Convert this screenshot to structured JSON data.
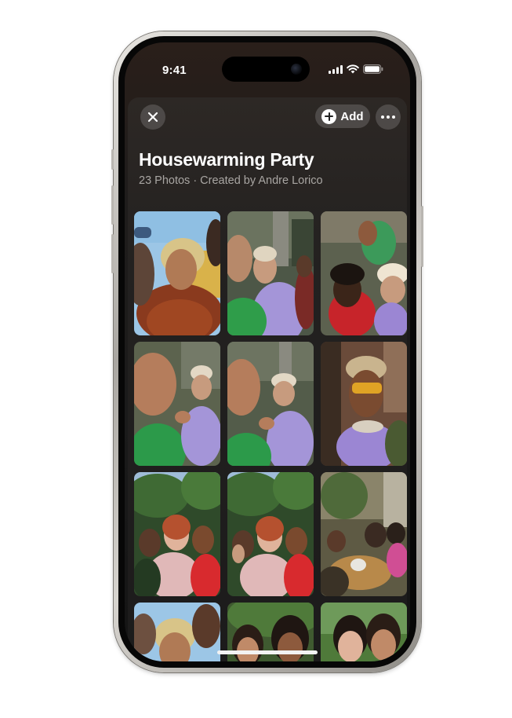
{
  "status_bar": {
    "time": "9:41",
    "icons": [
      "signal-icon",
      "wifi-icon",
      "battery-icon"
    ]
  },
  "header": {
    "close_icon": "close-icon",
    "add_label": "Add",
    "add_icon": "plus-circle-icon",
    "more_icon": "more-icon"
  },
  "album": {
    "title": "Housewarming Party",
    "subtitle": "23 Photos · Created by Andre Lorico"
  },
  "photos": [
    {
      "scene": "sunny selfie, curly blonde woman in red fur coat"
    },
    {
      "scene": "friends on balcony, man in beanie with lavender hoodie"
    },
    {
      "scene": "group selfie from below, man with braids"
    },
    {
      "scene": "laughing man in green jacket selfie"
    },
    {
      "scene": "balcony selfie with friends and beanie"
    },
    {
      "scene": "man with yellow sunglasses and beanie"
    },
    {
      "scene": "three women in front of trees"
    },
    {
      "scene": "three women peace sign in front of trees"
    },
    {
      "scene": "group seated outdoors at table"
    },
    {
      "scene": "selfie of friends under blue sky"
    },
    {
      "scene": "two women smiling in front of greenery"
    },
    {
      "scene": "two women smiling by window"
    }
  ],
  "colors": {
    "background": "#1c1b1b",
    "text": "#ffffff",
    "subtext": "#a9a6a3"
  }
}
